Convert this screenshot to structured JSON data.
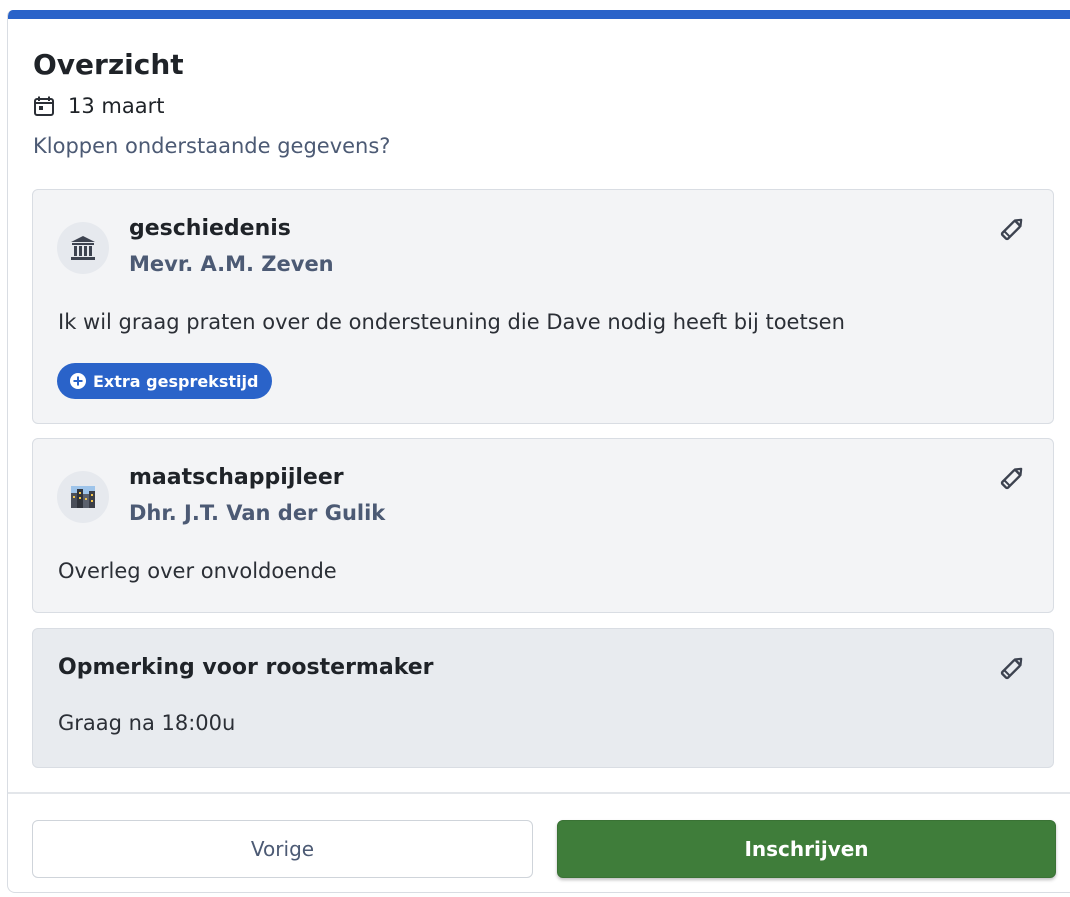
{
  "header": {
    "title": "Overzicht",
    "date": "13 maart",
    "question": "Kloppen onderstaande gegevens?"
  },
  "appointments": [
    {
      "subject": "geschiedenis",
      "teacher": "Mevr. A.M. Zeven",
      "message": "Ik wil graag praten over de ondersteuning die Dave nodig heeft bij toetsen",
      "badge": "Extra gesprekstijd",
      "icon": "museum-icon"
    },
    {
      "subject": "maatschappijleer",
      "teacher": "Dhr. J.T. Van der Gulik",
      "message": "Overleg over onvoldoende",
      "icon": "city-icon"
    }
  ],
  "note": {
    "title": "Opmerking voor roostermaker",
    "text": "Graag na 18:00u"
  },
  "footer": {
    "prev_label": "Vorige",
    "submit_label": "Inschrijven"
  },
  "colors": {
    "accent": "#2a63c9",
    "submit": "#3f7d3a",
    "muted_text": "#4c5a74",
    "card_bg": "#f3f4f6",
    "note_bg": "#e8ebef"
  }
}
